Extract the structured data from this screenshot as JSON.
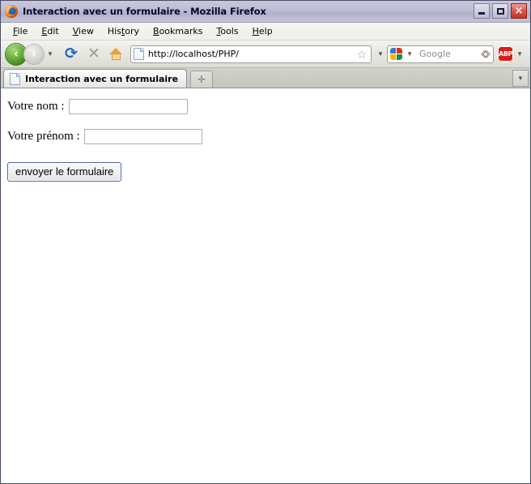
{
  "window": {
    "title": "Interaction avec un formulaire - Mozilla Firefox",
    "app_icon": "firefox-icon",
    "controls": {
      "minimize": "minimize-icon",
      "maximize": "maximize-icon",
      "close": "×"
    }
  },
  "menubar": {
    "items": [
      {
        "label": "File",
        "mnemonic": "F",
        "rest": "ile"
      },
      {
        "label": "Edit",
        "mnemonic": "E",
        "rest": "dit"
      },
      {
        "label": "View",
        "mnemonic": "V",
        "rest": "iew"
      },
      {
        "label": "History",
        "pre": "His",
        "mnemonic": "t",
        "rest": "ory"
      },
      {
        "label": "Bookmarks",
        "mnemonic": "B",
        "rest": "ookmarks"
      },
      {
        "label": "Tools",
        "mnemonic": "T",
        "rest": "ools"
      },
      {
        "label": "Help",
        "mnemonic": "H",
        "rest": "elp"
      }
    ]
  },
  "toolbar": {
    "back_icon": "‹",
    "forward_icon": "›",
    "nav_dropdown_icon": "▼",
    "reload_icon": "⟳",
    "stop_icon": "✕",
    "home_icon": "home-icon",
    "url": "http://localhost/PHP/",
    "url_favicon": "page-icon",
    "bookmark_star_icon": "☆",
    "bookmark_dropdown_icon": "▼",
    "search": {
      "engine_icon": "google-icon",
      "engine_dropdown_icon": "▼",
      "placeholder": "Google",
      "value": "",
      "magnifier_icon": "🔍"
    },
    "adblock": {
      "label": "ABP",
      "dropdown_icon": "▼"
    }
  },
  "tabbar": {
    "tabs": [
      {
        "title": "Interaction avec un formulaire",
        "favicon": "page-icon",
        "active": true
      }
    ],
    "new_tab_icon": "✛",
    "list_all_tabs_icon": "▼"
  },
  "page": {
    "fields": [
      {
        "label": "Votre nom :",
        "value": "",
        "placeholder": ""
      },
      {
        "label": "Votre prénom :",
        "value": "",
        "placeholder": ""
      }
    ],
    "submit_label": "envoyer le formulaire"
  },
  "colors": {
    "titlebar": "#bdbdd4",
    "close_button": "#c73323",
    "back_button": "#67ae3a",
    "reload_blue": "#1f66c4",
    "abp_red": "#d81f16",
    "submit_border": "#4a6d9e"
  }
}
